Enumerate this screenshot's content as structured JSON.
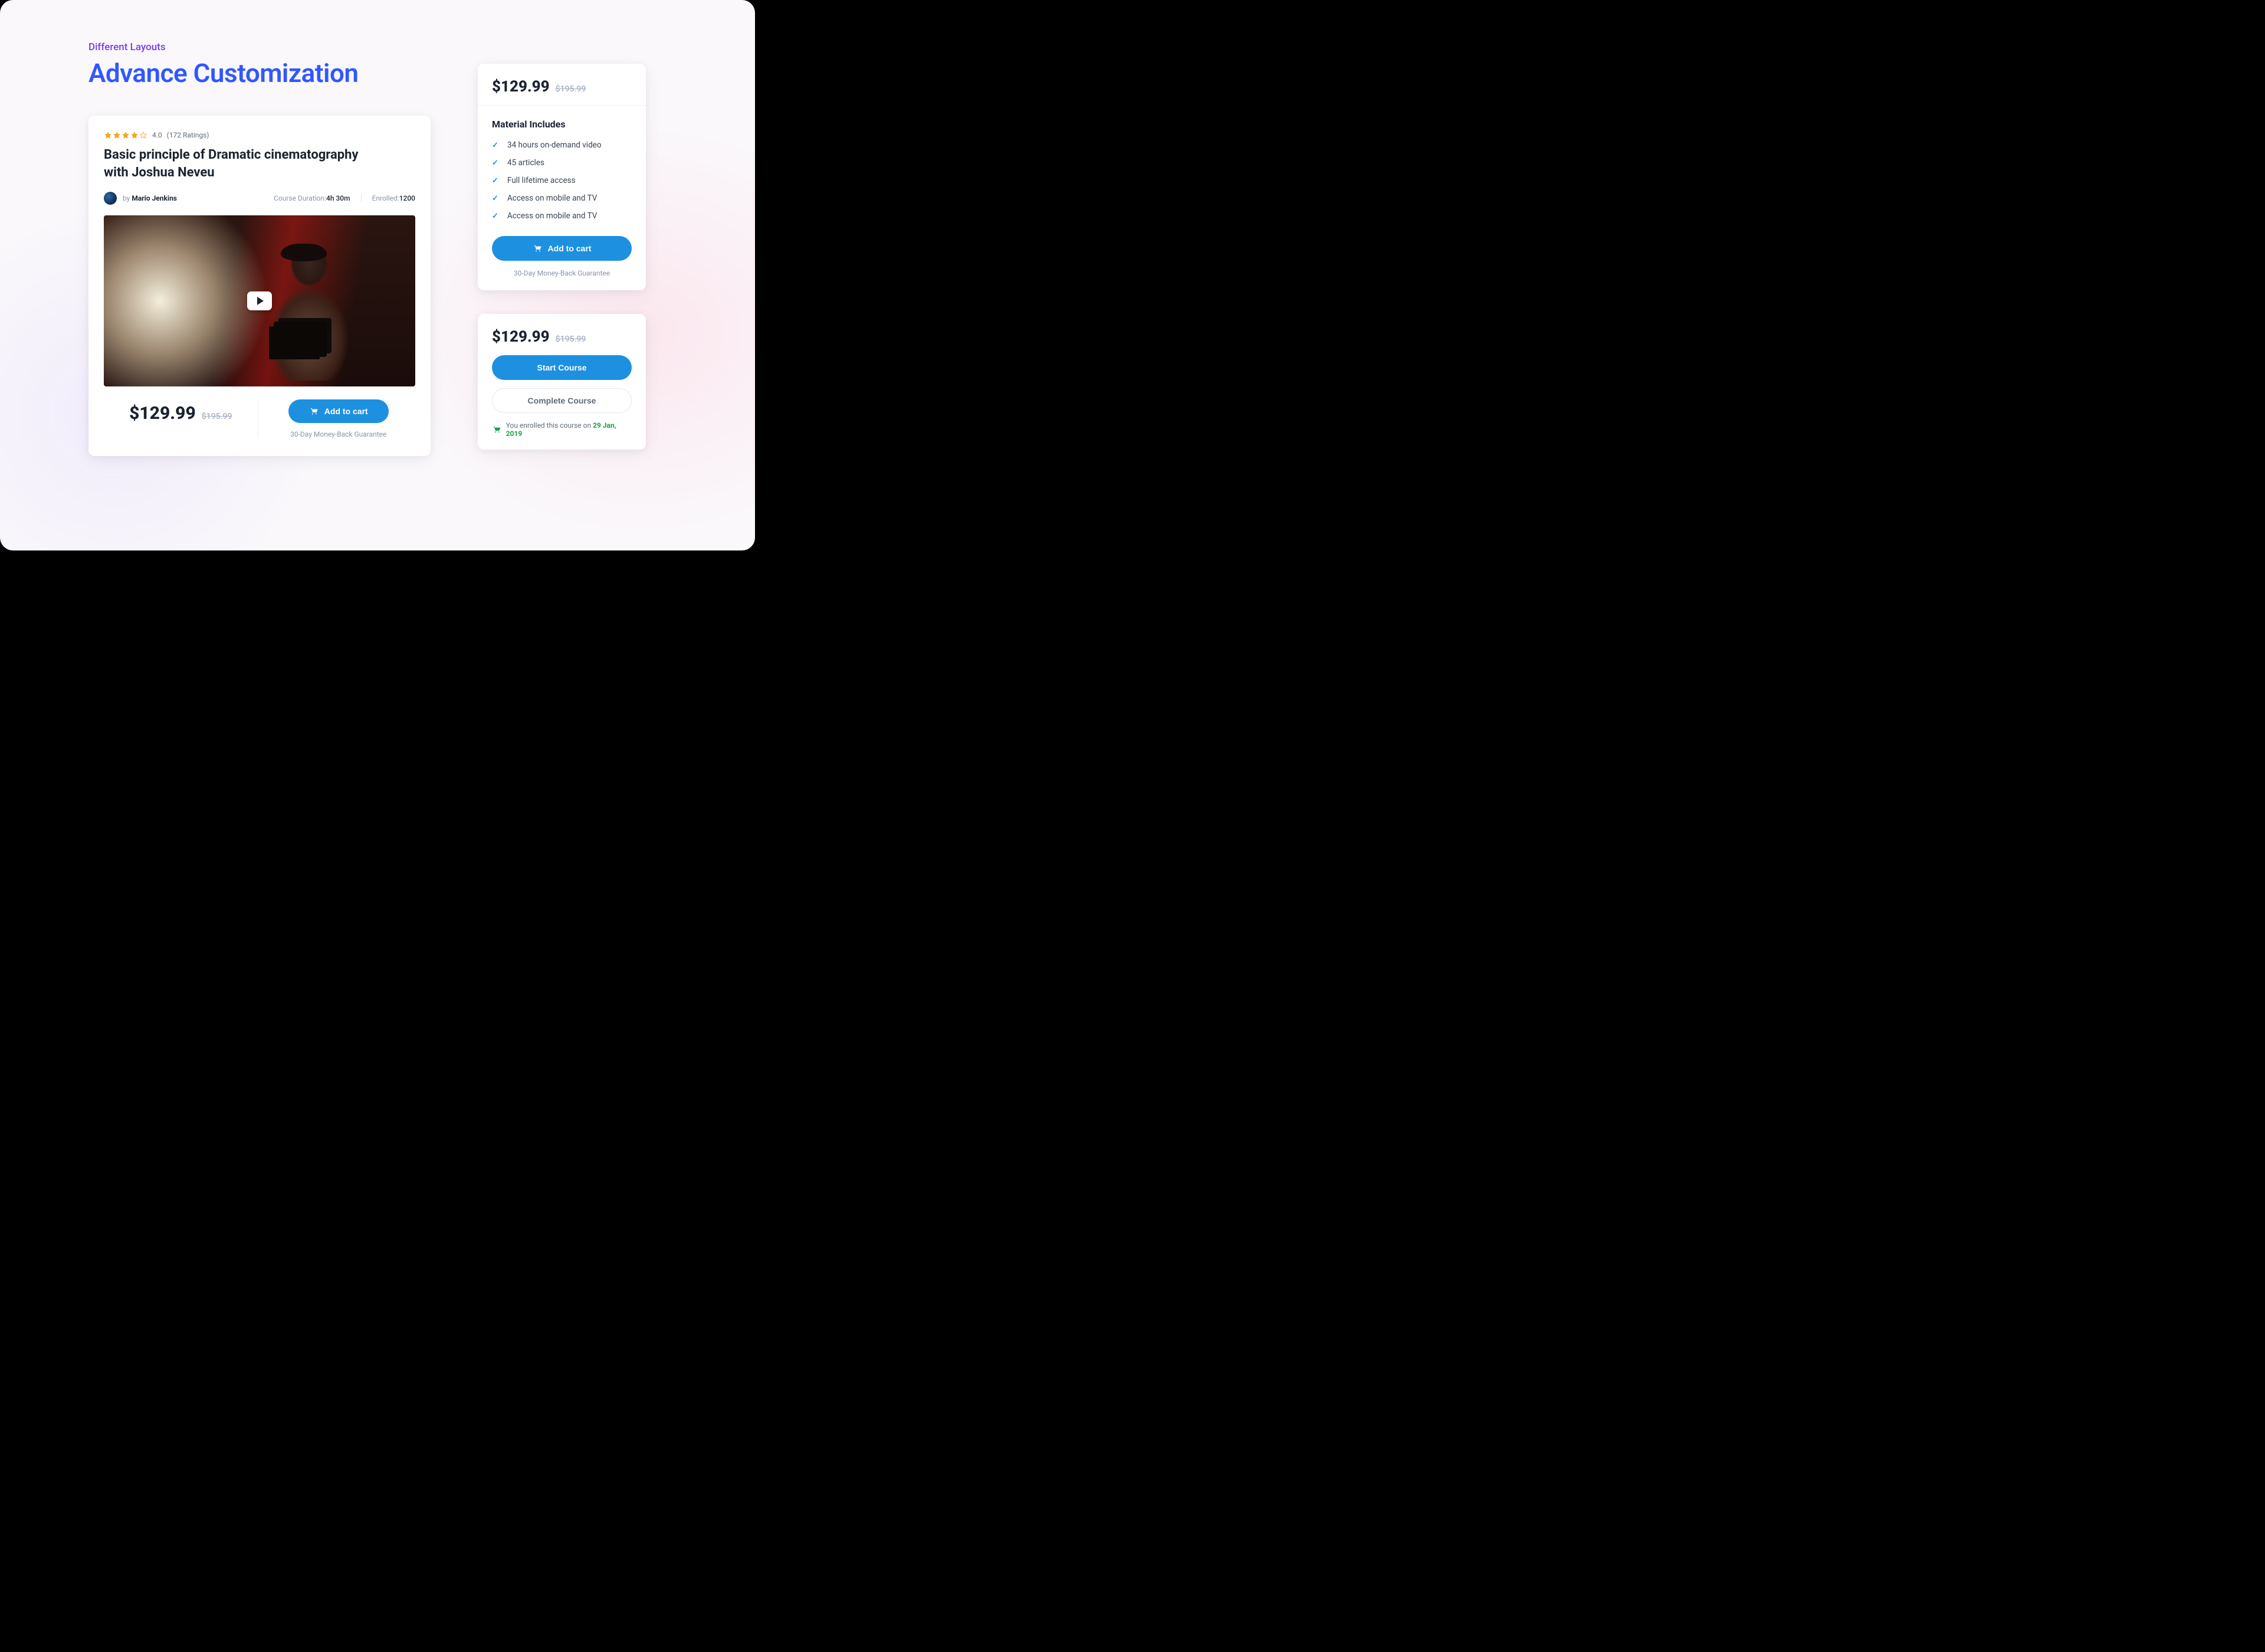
{
  "header": {
    "eyebrow": "Different Layouts",
    "headline": "Advance Customization"
  },
  "course": {
    "rating_value": "4.0",
    "rating_count_label": "(172 Ratings)",
    "title": "Basic principle of Dramatic cinematography with Joshua Neveu",
    "by_prefix": "by ",
    "author": "Mario Jenkins",
    "duration_label": "Course Duration: ",
    "duration_value": "4h 30m",
    "enrolled_label": "Enrolled: ",
    "enrolled_value": "1200",
    "price": "$129.99",
    "old_price": "$195.99",
    "add_to_cart": "Add to cart",
    "guarantee": "30-Day Money-Back Guarantee"
  },
  "side1": {
    "price": "$129.99",
    "old_price": "$195.99",
    "materials_title": "Material Includes",
    "items": [
      "34 hours on-demand video",
      "45 articles",
      "Full lifetime access",
      "Access on mobile and TV",
      "Access on mobile and TV"
    ],
    "add_to_cart": "Add to cart",
    "guarantee": "30-Day Money-Back Guarantee"
  },
  "side2": {
    "price": "$129.99",
    "old_price": "$195.99",
    "start": "Start Course",
    "complete": "Complete Course",
    "enrolled_prefix": "You enrolled this course on ",
    "enrolled_date": "29 Jan, 2019"
  }
}
